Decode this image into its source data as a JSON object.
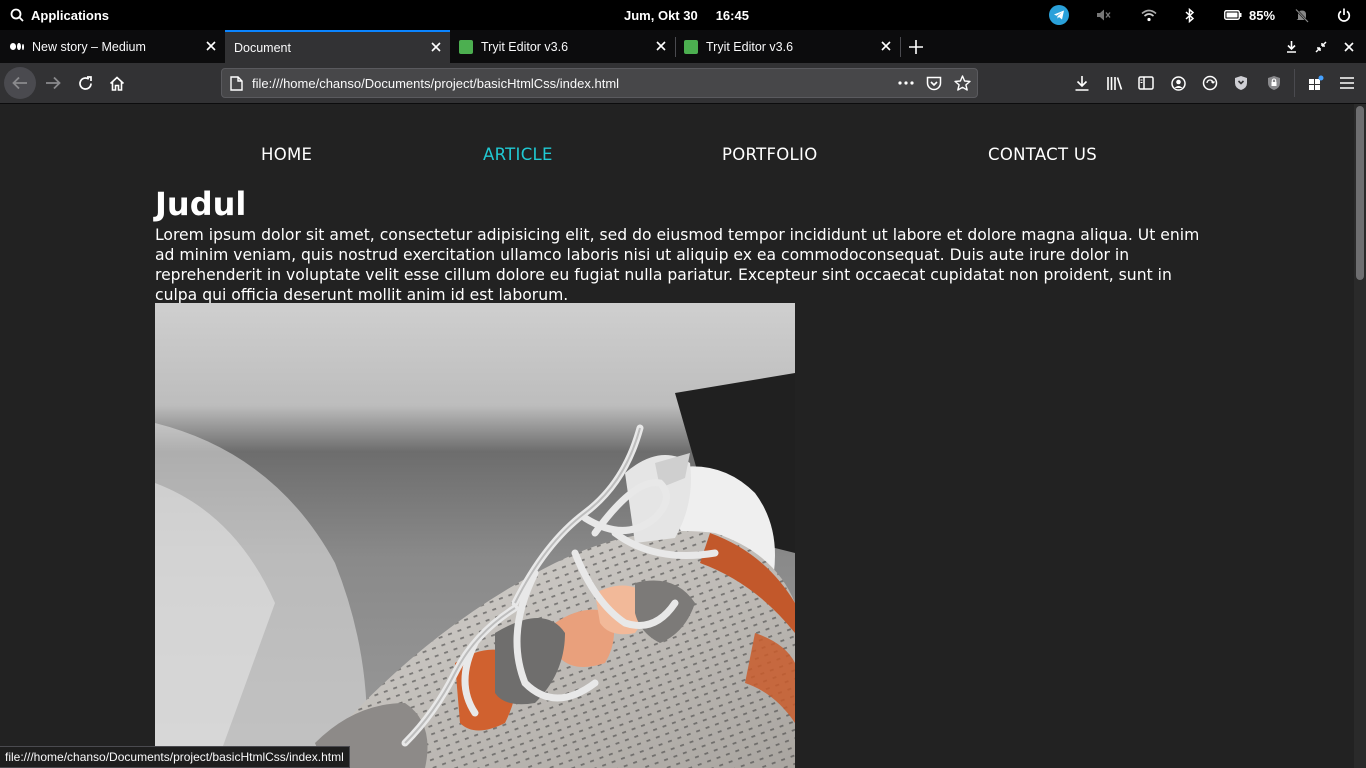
{
  "system": {
    "apps_label": "Applications",
    "date": "Jum, Okt 30",
    "time": "16:45",
    "battery": "85%"
  },
  "tabs": [
    {
      "label": "New story – Medium",
      "favicon": "medium-icon"
    },
    {
      "label": "Document",
      "favicon": "none"
    },
    {
      "label": "Tryit Editor v3.6",
      "favicon": "tryit-icon"
    },
    {
      "label": "Tryit Editor v3.6",
      "favicon": "tryit-icon"
    }
  ],
  "url": "file:///home/chanso/Documents/project/basicHtmlCss/index.html",
  "page": {
    "nav": [
      "HOME",
      "ARTICLE",
      "PORTFOLIO",
      "CONTACT US"
    ],
    "active_nav": "ARTICLE",
    "heading": "Judul",
    "paragraph": "Lorem ipsum dolor sit amet, consectetur adipisicing elit, sed do eiusmod tempor incididunt ut labore et dolore magna aliqua. Ut enim ad minim veniam, quis nostrud exercitation ullamco laboris nisi ut aliquip ex ea commodoconsequat. Duis aute irure dolor in reprehenderit in voluptate velit esse cillum dolore eu fugiat nulla pariatur. Excepteur sint occaecat cupidatat non proident, sunt in culpa qui officia deserunt mollit anim id est laborum."
  },
  "status_text": "file:///home/chanso/Documents/project/basicHtmlCss/index.html",
  "colors": {
    "accent": "#20c9d3",
    "page_bg": "#222222",
    "tab_highlight": "#0a84ff"
  }
}
